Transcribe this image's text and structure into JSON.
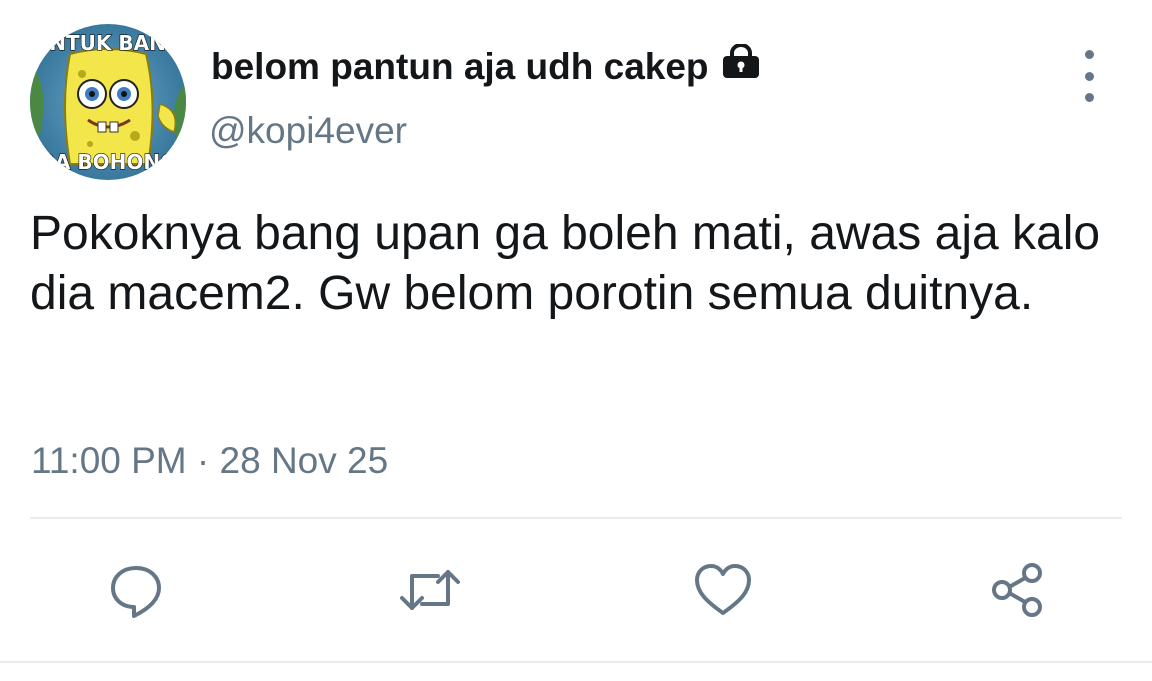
{
  "tweet": {
    "avatar": {
      "top_text": "ANTUK BANG",
      "bottom_text": "RA BOHONG",
      "icon": "spongebob-avatar"
    },
    "author": {
      "display_name": "belom pantun aja udh cakep",
      "handle": "@kopi4ever",
      "protected_icon": "lock-icon"
    },
    "body": "Pokoknya bang upan ga boleh mati, awas aja kalo dia macem2. Gw belom porotin semua duitnya.",
    "timestamp": "11:00 PM · 28 Nov 25",
    "actions": [
      {
        "name": "reply",
        "icon": "reply-icon"
      },
      {
        "name": "retweet",
        "icon": "retweet-icon"
      },
      {
        "name": "like",
        "icon": "heart-icon"
      },
      {
        "name": "share",
        "icon": "share-icon"
      }
    ],
    "colors": {
      "text": "#14171a",
      "secondary": "#657786",
      "divider": "#e6ecf0"
    }
  }
}
